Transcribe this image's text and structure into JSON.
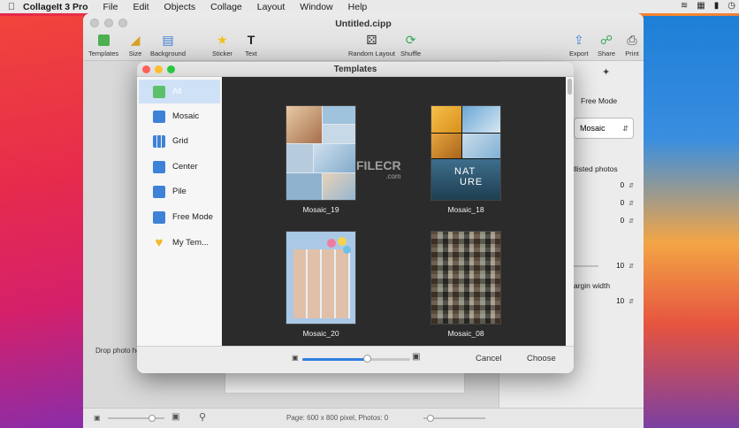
{
  "menubar": {
    "app_name": "CollageIt 3 Pro",
    "items": [
      "File",
      "Edit",
      "Objects",
      "Collage",
      "Layout",
      "Window",
      "Help"
    ]
  },
  "window": {
    "title": "Untitled.cipp",
    "toolbar": {
      "templates": "Templates",
      "size": "Size",
      "background": "Background",
      "sticker": "Sticker",
      "text": "Text",
      "random_layout": "Random Layout",
      "shuffle": "Shuffle",
      "export": "Export",
      "share": "Share",
      "print": "Print"
    },
    "drop_label": "Drop photo here",
    "add_symbol": "+",
    "remove_symbol": "−",
    "status": "Page: 600 x 800 pixel, Photos: 0"
  },
  "right_panel": {
    "mode_label": "Free Mode",
    "select_value": "Mosaic",
    "listed_photos_label": "llisted photos",
    "steppers": [
      "0",
      "0",
      "0"
    ],
    "value_10a": "10",
    "margin_label": "argin width",
    "value_10b": "10"
  },
  "dialog": {
    "title": "Templates",
    "sidebar": [
      {
        "label": "All",
        "icon": "all-templates-icon"
      },
      {
        "label": "Mosaic",
        "icon": "mosaic-icon"
      },
      {
        "label": "Grid",
        "icon": "grid-icon"
      },
      {
        "label": "Center",
        "icon": "center-icon"
      },
      {
        "label": "Pile",
        "icon": "pile-icon"
      },
      {
        "label": "Free Mode",
        "icon": "free-mode-icon"
      },
      {
        "label": "My Tem...",
        "icon": "heart-icon"
      }
    ],
    "templates": [
      {
        "name": "Mosaic_19"
      },
      {
        "name": "Mosaic_18"
      },
      {
        "name": "Mosaic_20"
      },
      {
        "name": "Mosaic_08"
      }
    ],
    "thumb_texts": {
      "nature_1": "NAT",
      "nature_2": "URE"
    },
    "zoom_level": 0.6,
    "cancel": "Cancel",
    "choose": "Choose"
  },
  "watermark": {
    "brand": "FILECR",
    "suffix": ".com"
  },
  "colors": {
    "accent": "#2f7fe0",
    "selection": "#cfe1f6",
    "close": "#fe5f57",
    "minimize": "#febc2e",
    "zoom": "#28c840"
  }
}
